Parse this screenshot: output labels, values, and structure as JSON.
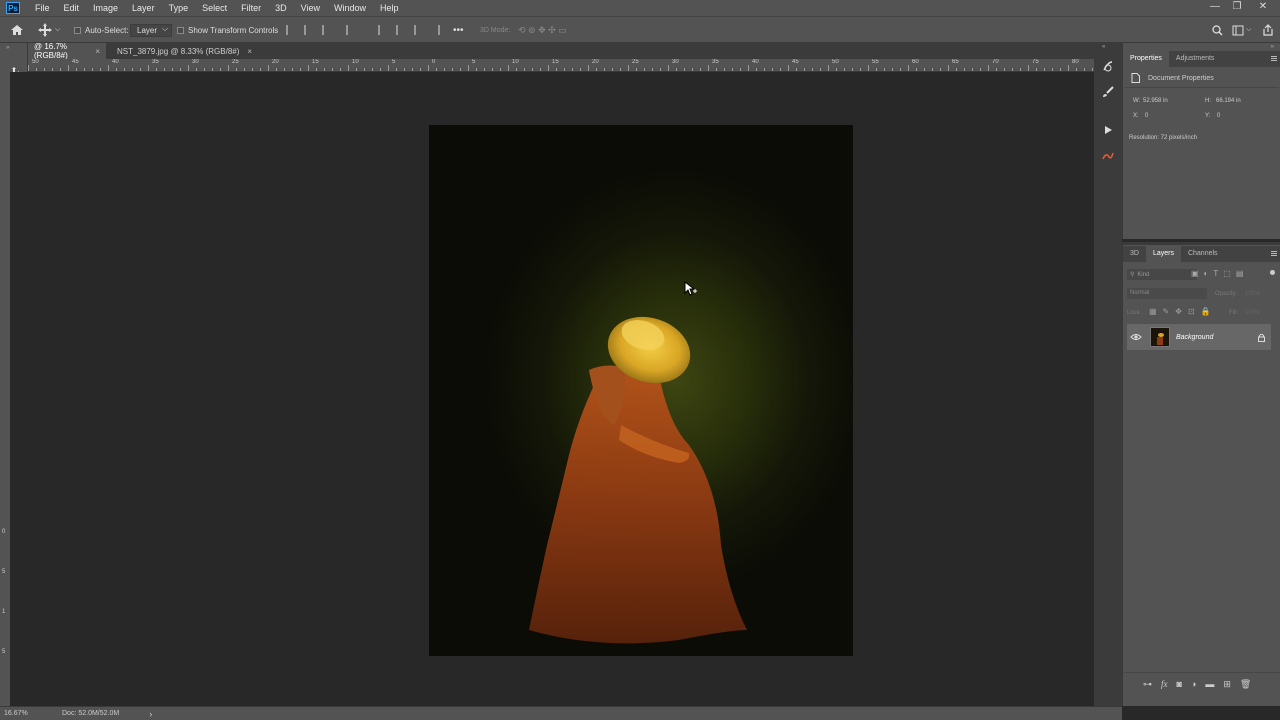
{
  "app": {
    "logo": "Ps"
  },
  "menu": [
    "File",
    "Edit",
    "Image",
    "Layer",
    "Type",
    "Select",
    "Filter",
    "3D",
    "View",
    "Window",
    "Help"
  ],
  "options": {
    "auto_select": "Auto-Select:",
    "layer_dropdown": "Layer",
    "show_transform": "Show Transform Controls",
    "more": "•••",
    "mode_3d": "3D Mode:"
  },
  "tabs": [
    {
      "label": "@ 16.7% (RGB/8#)",
      "close": "×"
    },
    {
      "label": "NST_3879.jpg @ 8.33% (RGB/8#)",
      "close": "×"
    }
  ],
  "ruler_h": [
    "50",
    "45",
    "40",
    "35",
    "30",
    "25",
    "20",
    "15",
    "10",
    "5",
    "0",
    "5",
    "10",
    "15",
    "20",
    "25",
    "30",
    "35",
    "40",
    "45",
    "50",
    "55",
    "60",
    "65",
    "70",
    "75",
    "80"
  ],
  "ruler_v": [
    "0",
    "5",
    "1",
    "5"
  ],
  "statusbar": {
    "zoom": "16.67%",
    "doc": "Doc: 52.0M/52.0M",
    "arrow": "›"
  },
  "properties": {
    "tabs": [
      "Properties",
      "Adjustments"
    ],
    "title": "Document Properties",
    "w_label": "W:",
    "w_value": "52.958 in",
    "h_label": "H:",
    "h_value": "66.194 in",
    "x_label": "X:",
    "x_value": "0",
    "y_label": "Y:",
    "y_value": "0",
    "resolution": "Resolution: 72 pixels/inch"
  },
  "layers": {
    "tabs": [
      "3D",
      "Layers",
      "Channels"
    ],
    "kind": "Kind",
    "blend": "Normal",
    "opacity_label": "Opacity:",
    "opacity_value": "100%",
    "lock_label": "Lock:",
    "fill_label": "Fill:",
    "fill_value": "100%",
    "layer_name": "Background"
  },
  "colors": {
    "bg": "#282828",
    "panel": "#535353",
    "accent": "#31a8ff"
  }
}
